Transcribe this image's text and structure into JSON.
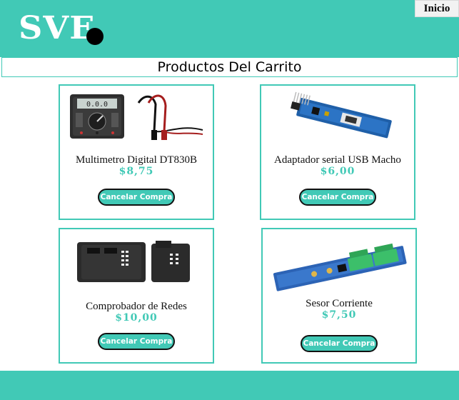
{
  "header": {
    "logo_text": "SVE",
    "home_label": "Inicio",
    "accent_color": "#41c9b6"
  },
  "page_title": "Productos Del Carrito",
  "products": [
    {
      "name": "Multimetro Digital DT830B",
      "price": "$8,75",
      "image_icon": "multimeter-image",
      "cancel_label": "Cancelar Compra"
    },
    {
      "name": "Adaptador serial USB Macho",
      "price": "$6,00",
      "image_icon": "usb-serial-adapter-image",
      "cancel_label": "Cancelar Compra"
    },
    {
      "name": "Comprobador de Redes",
      "price": "$10,00",
      "image_icon": "network-tester-image",
      "cancel_label": "Cancelar Compra"
    },
    {
      "name": "Sesor Corriente",
      "price": "$7,50",
      "image_icon": "current-sensor-image",
      "cancel_label": "Cancelar Compra"
    }
  ]
}
